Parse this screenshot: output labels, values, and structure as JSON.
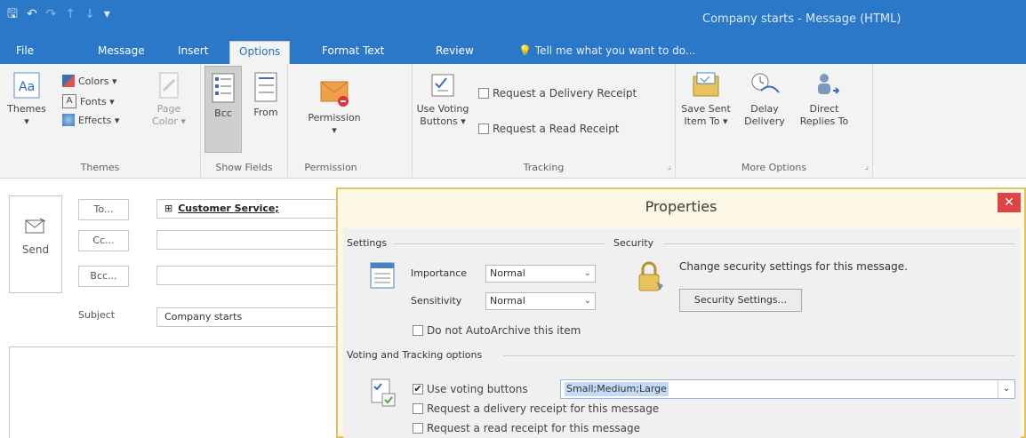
{
  "window": {
    "title": "Company starts - Message (HTML)"
  },
  "tabs": {
    "items": [
      {
        "label": "File"
      },
      {
        "label": "Message"
      },
      {
        "label": "Insert"
      },
      {
        "label": "Options"
      },
      {
        "label": "Format Text"
      },
      {
        "label": "Review"
      }
    ],
    "tell_me": "Tell me what you want to do..."
  },
  "ribbon": {
    "themes": {
      "themes_label": "Themes",
      "colors_label": "Colors ▾",
      "fonts_label": "Fonts ▾",
      "effects_label": "Effects ▾",
      "page_color_label1": "Page",
      "page_color_label2": "Color ▾",
      "group_label": "Themes"
    },
    "show_fields": {
      "bcc_label": "Bcc",
      "from_label": "From",
      "group_label": "Show Fields"
    },
    "permission": {
      "permission_label": "Permission",
      "dropdown": "▾",
      "group_label": "Permission"
    },
    "tracking": {
      "use_voting_label1": "Use Voting",
      "use_voting_label2": "Buttons ▾",
      "delivery_receipt_label": "Request a Delivery Receipt",
      "read_receipt_label": "Request a Read Receipt",
      "group_label": "Tracking"
    },
    "more_options": {
      "save_sent_label1": "Save Sent",
      "save_sent_label2": "Item To ▾",
      "delay_label1": "Delay",
      "delay_label2": "Delivery",
      "direct_label1": "Direct",
      "direct_label2": "Replies To",
      "group_label": "More Options"
    }
  },
  "compose": {
    "send_label": "Send",
    "to_label": "To...",
    "cc_label": "Cc...",
    "bcc_label": "Bcc...",
    "subject_label": "Subject",
    "to_value": "Customer Service;",
    "subject_value": "Company starts"
  },
  "dialog": {
    "title": "Properties",
    "close": "✕",
    "settings": {
      "section_label": "Settings",
      "importance_label": "Importance",
      "importance_value": "Normal",
      "sensitivity_label": "Sensitivity",
      "sensitivity_value": "Normal",
      "no_autoarchive_label": "Do not AutoArchive this item"
    },
    "security": {
      "section_label": "Security",
      "description": "Change security settings for this message.",
      "button_label": "Security Settings..."
    },
    "voting": {
      "section_label": "Voting and Tracking options",
      "use_voting_label": "Use voting buttons",
      "use_voting_checked": true,
      "voting_value": "Small;Medium;Large",
      "delivery_receipt_label": "Request a delivery receipt for this message",
      "read_receipt_label": "Request a read receipt for this message"
    }
  },
  "colors": {
    "accent": "#2b78c9",
    "dialog_border": "#e6c25c",
    "close_red": "#e04343"
  }
}
